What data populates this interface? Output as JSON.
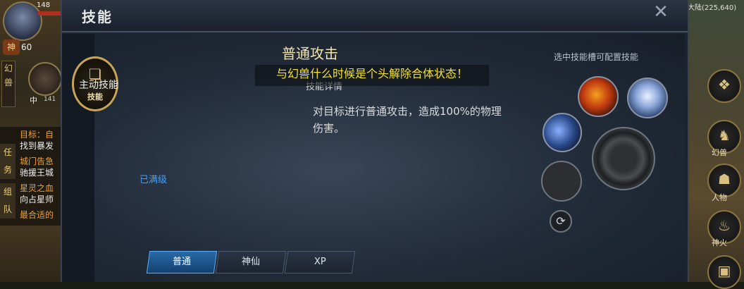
{
  "window": {
    "title": "技能"
  },
  "left_hud": {
    "hp_value": "148",
    "shen_label": "神",
    "shen_value": "60",
    "pet_label": "幻兽",
    "pet_level_label": "中",
    "pet_value": "141",
    "quest_tabs": [
      "任务",
      "组队"
    ],
    "quest_lines": [
      {
        "text": "目标：自",
        "color": "#f0a030"
      },
      {
        "text": "找到暴发",
        "color": "#eeeeee"
      },
      {
        "text": "城门告急",
        "color": "#f0a030"
      },
      {
        "text": "驰援王城",
        "color": "#eeeeee"
      },
      {
        "text": "星灵之血",
        "color": "#f0a030"
      },
      {
        "text": "向占星师",
        "color": "#eeeeee"
      },
      {
        "text": "最合适的",
        "color": "#f0a030"
      }
    ]
  },
  "emblem": {
    "label": "技能",
    "icon": "book-icon"
  },
  "skill": {
    "name": "普通攻击",
    "type": "主动技能",
    "detail_header": "技能详情",
    "description": "对目标进行普通攻击，造成100%的物理伤害。",
    "status": "已满级"
  },
  "toast": "与幻兽什么时候是个头解除合体状态！",
  "slots": {
    "hint": "选中技能槽可配置技能",
    "items": [
      {
        "icon": "phoenix-skill-icon"
      },
      {
        "icon": "silhouette-skill-icon"
      },
      {
        "icon": "dash-skill-icon"
      },
      {
        "icon": "empty-slot"
      }
    ],
    "swap_icon": "swap-icon"
  },
  "tabs": [
    {
      "label": "普通",
      "active": true
    },
    {
      "label": "神仙",
      "active": false
    },
    {
      "label": "XP",
      "active": false
    }
  ],
  "right_hud": {
    "coords": "大陆(225,640)",
    "buttons": [
      {
        "label": "",
        "icon": "diamond-grid-icon"
      },
      {
        "label": "幻兽",
        "icon": "beast-icon"
      },
      {
        "label": "人物",
        "icon": "character-icon"
      },
      {
        "label": "神火",
        "icon": "fire-icon"
      },
      {
        "label": "",
        "icon": "chest-icon"
      }
    ]
  },
  "colors": {
    "accent_gold": "#c8a458",
    "toast_yellow": "#f4e22a",
    "maxed_blue": "#3fa0ff",
    "tab_active": "#2a6aa8"
  }
}
